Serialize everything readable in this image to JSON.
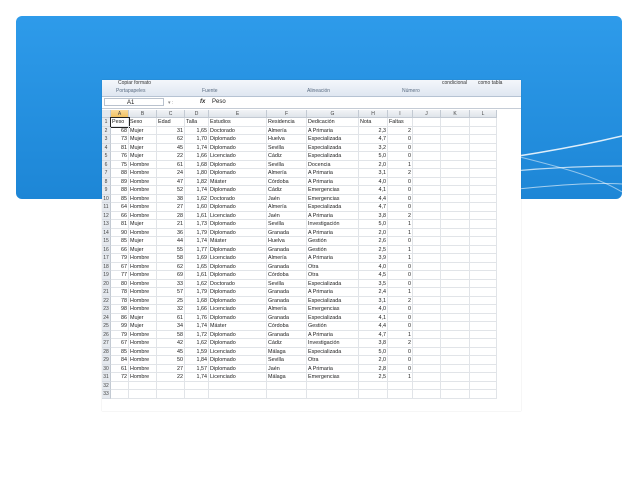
{
  "ribbon": {
    "top_left": "Copiar formato",
    "top_right": [
      "condicional",
      "como tabla"
    ],
    "groups": [
      "Portapapeles",
      "Fuente",
      "Alineación",
      "Número"
    ]
  },
  "formula_bar": {
    "name_box": "A1",
    "fx": "fx",
    "value": "Peso"
  },
  "columns": [
    "A",
    "B",
    "C",
    "D",
    "E",
    "F",
    "G",
    "H",
    "I",
    "J",
    "K",
    "L"
  ],
  "headers": [
    "Peso",
    "Sexo",
    "Edad",
    "Talla",
    "Estudios",
    "Residencia",
    "Dedicación",
    "Nota",
    "Faltas"
  ],
  "rows": [
    [
      "68",
      "Mujer",
      "31",
      "1,65",
      "Doctorado",
      "Almería",
      "A Primaria",
      "2,3",
      "2"
    ],
    [
      "73",
      "Mujer",
      "62",
      "1,70",
      "Diplomado",
      "Huelva",
      "Especializada",
      "4,7",
      "0"
    ],
    [
      "81",
      "Mujer",
      "45",
      "1,74",
      "Diplomado",
      "Sevilla",
      "Especializada",
      "3,2",
      "0"
    ],
    [
      "76",
      "Mujer",
      "22",
      "1,66",
      "Licenciado",
      "Cádiz",
      "Especializada",
      "5,0",
      "0"
    ],
    [
      "75",
      "Hombre",
      "61",
      "1,68",
      "Diplomado",
      "Sevilla",
      "Docencia",
      "2,0",
      "1"
    ],
    [
      "88",
      "Hombre",
      "24",
      "1,80",
      "Diplomado",
      "Almería",
      "A Primaria",
      "3,1",
      "2"
    ],
    [
      "89",
      "Hombre",
      "47",
      "1,82",
      "Máster",
      "Córdoba",
      "A Primaria",
      "4,0",
      "0"
    ],
    [
      "88",
      "Hombre",
      "52",
      "1,74",
      "Diplomado",
      "Cádiz",
      "Emergencias",
      "4,1",
      "0"
    ],
    [
      "85",
      "Hombre",
      "38",
      "1,62",
      "Doctorado",
      "Jaén",
      "Emergencias",
      "4,4",
      "0"
    ],
    [
      "64",
      "Hombre",
      "27",
      "1,60",
      "Diplomado",
      "Almería",
      "Especializada",
      "4,7",
      "0"
    ],
    [
      "66",
      "Hombre",
      "28",
      "1,61",
      "Licenciado",
      "Jaén",
      "A Primaria",
      "3,8",
      "2"
    ],
    [
      "81",
      "Mujer",
      "21",
      "1,73",
      "Diplomado",
      "Sevilla",
      "Investigación",
      "5,0",
      "1"
    ],
    [
      "90",
      "Hombre",
      "36",
      "1,79",
      "Diplomado",
      "Granada",
      "A Primaria",
      "2,0",
      "1"
    ],
    [
      "85",
      "Mujer",
      "44",
      "1,74",
      "Máster",
      "Huelva",
      "Gestión",
      "2,6",
      "0"
    ],
    [
      "66",
      "Mujer",
      "55",
      "1,77",
      "Diplomado",
      "Granada",
      "Gestión",
      "2,5",
      "1"
    ],
    [
      "79",
      "Hombre",
      "58",
      "1,69",
      "Licenciado",
      "Almería",
      "A Primaria",
      "3,9",
      "1"
    ],
    [
      "67",
      "Hombre",
      "62",
      "1,65",
      "Diplomado",
      "Granada",
      "Otra",
      "4,0",
      "0"
    ],
    [
      "77",
      "Hombre",
      "69",
      "1,61",
      "Diplomado",
      "Córdoba",
      "Otra",
      "4,5",
      "0"
    ],
    [
      "80",
      "Hombre",
      "33",
      "1,62",
      "Doctorado",
      "Sevilla",
      "Especializada",
      "3,5",
      "0"
    ],
    [
      "78",
      "Hombre",
      "57",
      "1,79",
      "Diplomado",
      "Granada",
      "A Primaria",
      "2,4",
      "1"
    ],
    [
      "78",
      "Hombre",
      "25",
      "1,68",
      "Diplomado",
      "Granada",
      "Especializada",
      "3,1",
      "2"
    ],
    [
      "98",
      "Hombre",
      "32",
      "1,66",
      "Licenciado",
      "Almería",
      "Emergencias",
      "4,0",
      "0"
    ],
    [
      "86",
      "Mujer",
      "61",
      "1,76",
      "Diplomado",
      "Granada",
      "Especializada",
      "4,1",
      "0"
    ],
    [
      "99",
      "Mujer",
      "34",
      "1,74",
      "Máster",
      "Córdoba",
      "Gestión",
      "4,4",
      "0"
    ],
    [
      "79",
      "Hombre",
      "58",
      "1,72",
      "Diplomado",
      "Granada",
      "A Primaria",
      "4,7",
      "1"
    ],
    [
      "67",
      "Hombre",
      "42",
      "1,62",
      "Diplomado",
      "Cádiz",
      "Investigación",
      "3,8",
      "2"
    ],
    [
      "85",
      "Hombre",
      "45",
      "1,59",
      "Licenciado",
      "Málaga",
      "Especializada",
      "5,0",
      "0"
    ],
    [
      "84",
      "Hombre",
      "50",
      "1,84",
      "Diplomado",
      "Sevilla",
      "Otra",
      "2,0",
      "0"
    ],
    [
      "61",
      "Hombre",
      "27",
      "1,57",
      "Diplomado",
      "Jaén",
      "A Primaria",
      "2,8",
      "0"
    ],
    [
      "72",
      "Hombre",
      "22",
      "1,74",
      "Licenciado",
      "Málaga",
      "Emergencias",
      "2,5",
      "1"
    ]
  ],
  "empty_row_numbers": [
    "32",
    "33"
  ]
}
